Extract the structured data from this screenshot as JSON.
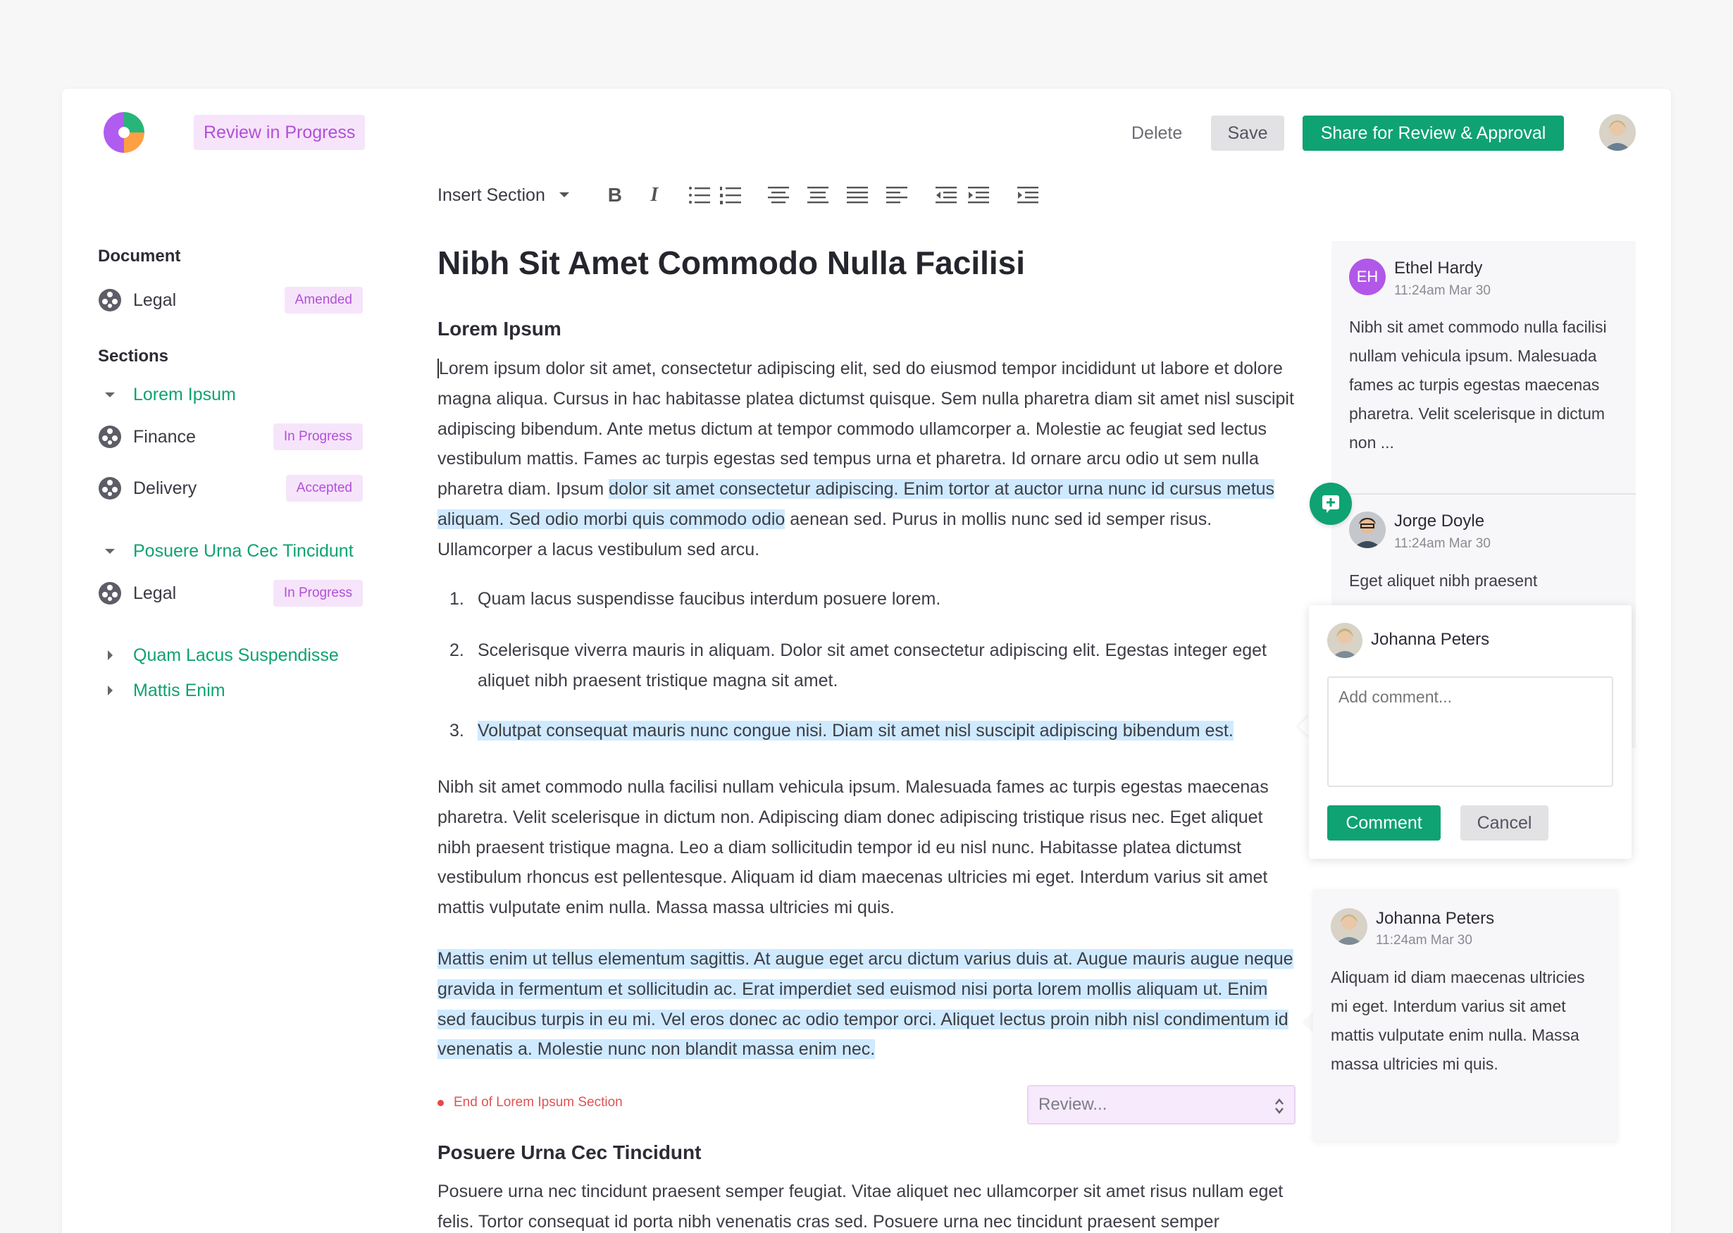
{
  "header": {
    "status": "Review in Progress",
    "delete_label": "Delete",
    "save_label": "Save",
    "share_label": "Share for Review & Approval"
  },
  "toolbar": {
    "insert_section_label": "Insert Section",
    "icons": [
      "bold-icon",
      "italic-icon",
      "bullet-list-icon",
      "numbered-list-icon",
      "align-center-icon",
      "align-middle-icon",
      "align-justify-icon",
      "align-left-icon",
      "outdent-icon",
      "indent-icon",
      "indent-more-icon"
    ]
  },
  "sidebar": {
    "document_heading": "Document",
    "document_item": {
      "label": "Legal",
      "badge": "Amended"
    },
    "sections_heading": "Sections",
    "groups": [
      {
        "title": "Lorem Ipsum",
        "items": [
          {
            "label": "Finance",
            "badge": "In Progress"
          },
          {
            "label": "Delivery",
            "badge": "Accepted"
          }
        ]
      },
      {
        "title": "Posuere Urna Cec Tincidunt",
        "items": [
          {
            "label": "Legal",
            "badge": "In Progress"
          }
        ]
      }
    ],
    "collapsed": [
      "Quam Lacus Suspendisse",
      "Mattis Enim"
    ]
  },
  "editor": {
    "title": "Nibh Sit Amet Commodo Nulla Facilisi",
    "section1_title": "Lorem Ipsum",
    "p1_a": "Lorem ipsum dolor sit amet, consectetur adipiscing elit, sed do eiusmod tempor incididunt ut labore et dolore magna aliqua. Cursus in hac habitasse platea dictumst quisque. Sem nulla pharetra diam sit amet nisl suscipit adipiscing bibendum. Ante metus dictum at tempor commodo ullamcorper a. Molestie ac feugiat sed lectus vestibulum mattis. Fames ac turpis egestas sed tempus urna et pharetra. Id ornare arcu odio ut sem nulla pharetra diam. Ipsum ",
    "p1_hl": "dolor sit amet consectetur adipiscing. Enim tortor at auctor urna nunc id cursus metus aliquam. Sed odio morbi quis commodo odio",
    "p1_b": " aenean sed. Purus in mollis nunc sed id semper risus. Ullamcorper a lacus vestibulum sed arcu.",
    "list": [
      {
        "num": "1.",
        "text": "Quam lacus suspendisse faucibus interdum posuere lorem."
      },
      {
        "num": "2.",
        "text": "Scelerisque viverra mauris in aliquam. Dolor sit amet consectetur adipiscing elit. Egestas integer eget aliquet nibh praesent tristique magna sit amet."
      },
      {
        "num": "3.",
        "text": "Volutpat consequat mauris nunc congue nisi. Diam sit amet nisl suscipit adipiscing bibendum est."
      }
    ],
    "p2": "Nibh sit amet commodo nulla facilisi nullam vehicula ipsum. Malesuada fames ac turpis egestas maecenas pharetra. Velit scelerisque in dictum non. Adipiscing diam donec adipiscing tristique risus nec. Eget aliquet nibh praesent tristique magna. Leo a diam sollicitudin tempor id eu nisl nunc. Habitasse platea dictumst vestibulum rhoncus est pellentesque. Aliquam id diam maecenas ultricies mi eget. Interdum varius sit amet mattis vulputate enim nulla. Massa massa ultricies mi quis.",
    "p3": "Mattis enim ut tellus elementum sagittis. At augue eget arcu dictum varius duis at. Augue mauris augue neque gravida in fermentum et sollicitudin ac. Erat imperdiet sed euismod nisi porta lorem mollis aliquam ut. Enim sed faucibus turpis in eu mi. Vel eros donec ac odio tempor orci. Aliquet lectus proin nibh nisl condimentum id venenatis a. Molestie nunc non blandit massa enim nec.",
    "end_marker": "End of Lorem Ipsum Section",
    "review_placeholder": "Review...",
    "section2_title": "Posuere Urna Cec Tincidunt",
    "p4": "Posuere urna nec tincidunt praesent semper feugiat. Vitae aliquet nec ullamcorper sit amet risus nullam eget felis. Tortor consequat id porta nibh venenatis cras sed. Posuere urna nec tincidunt praesent semper"
  },
  "comments": [
    {
      "initials": "EH",
      "name": "Ethel Hardy",
      "time": "11:24am Mar 30",
      "body": "Nibh sit amet commodo nulla facilisi nullam vehicula ipsum. Malesuada fames ac turpis egestas maecenas pharetra. Velit scelerisque in dictum non ..."
    },
    {
      "name": "Jorge Doyle",
      "time": "11:24am Mar 30",
      "body": "Eget aliquet nibh praesent"
    },
    {
      "name": "Johanna Peters",
      "time": "11:24am Mar 30",
      "body": "Aliquam id diam maecenas ultricies mi eget. Interdum varius sit amet mattis vulputate enim nulla. Massa massa ultricies mi quis."
    }
  ],
  "new_comment": {
    "author": "Johanna Peters",
    "placeholder": "Add comment...",
    "comment_label": "Comment",
    "cancel_label": "Cancel"
  },
  "colors": {
    "accent": "#0fa272",
    "badge_bg": "#f6e4fb",
    "badge_text": "#b24fd8",
    "highlight": "#cfeaff"
  }
}
